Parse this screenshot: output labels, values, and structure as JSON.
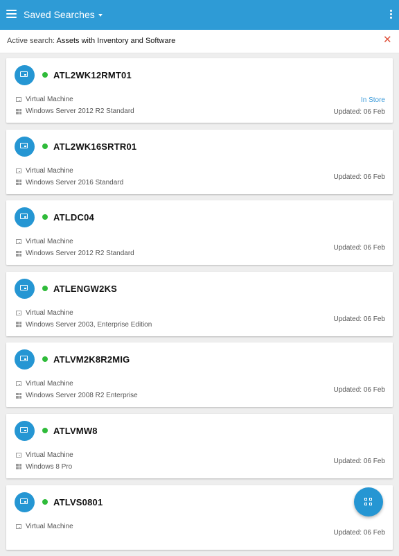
{
  "appbar": {
    "title": "Saved Searches",
    "menu_icon": "hamburger-menu-icon",
    "dropdown_icon": "caret-down-icon",
    "overflow_icon": "kebab-menu-icon",
    "background_color": "#2e9bd6"
  },
  "active_search": {
    "label": "Active search:",
    "value": "Assets with Inventory and Software",
    "clear_icon": "close-icon",
    "clear_glyph": "✕"
  },
  "assets": [
    {
      "name": "ATL2WK12RMT01",
      "type": "Virtual Machine",
      "os": "Windows Server 2012 R2 Standard",
      "tag": "In Store",
      "updated": "Updated: 06 Feb",
      "status": "online"
    },
    {
      "name": "ATL2WK16SRTR01",
      "type": "Virtual Machine",
      "os": "Windows Server 2016 Standard",
      "tag": "",
      "updated": "Updated: 06 Feb",
      "status": "online"
    },
    {
      "name": "ATLDC04",
      "type": "Virtual Machine",
      "os": "Windows Server 2012 R2 Standard",
      "tag": "",
      "updated": "Updated: 06 Feb",
      "status": "online"
    },
    {
      "name": "ATLENGW2KS",
      "type": "Virtual Machine",
      "os": "Windows Server 2003, Enterprise Edition",
      "tag": "",
      "updated": "Updated: 06 Feb",
      "status": "online"
    },
    {
      "name": "ATLVM2K8R2MIG",
      "type": "Virtual Machine",
      "os": "Windows Server 2008 R2 Enterprise",
      "tag": "",
      "updated": "Updated: 06 Feb",
      "status": "online"
    },
    {
      "name": "ATLVMW8",
      "type": "Virtual Machine",
      "os": "Windows 8 Pro",
      "tag": "",
      "updated": "Updated: 06 Feb",
      "status": "online"
    },
    {
      "name": "ATLVS0801",
      "type": "Virtual Machine",
      "os": "",
      "tag": "",
      "updated": "Updated: 06 Feb",
      "status": "online"
    }
  ],
  "fab": {
    "icon": "qr-code-scan-icon"
  },
  "colors": {
    "accent": "#2596d3",
    "status_online": "#2fbb3a",
    "in_store": "#3a9ad9",
    "clear": "#e0523c"
  }
}
